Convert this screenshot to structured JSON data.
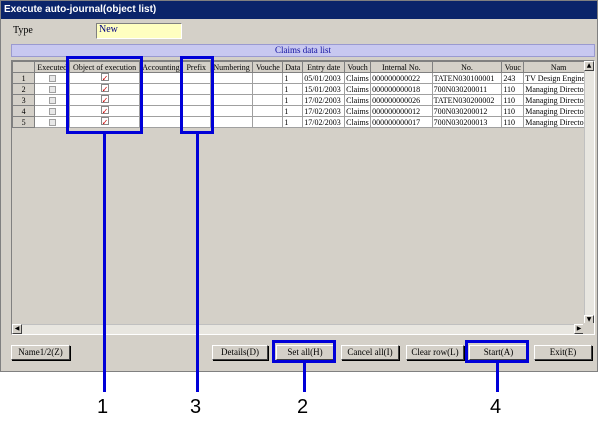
{
  "window": {
    "title": "Execute auto-journal(object list)"
  },
  "form": {
    "type_label": "Type",
    "type_value": "New"
  },
  "grid": {
    "caption": "Claims data list",
    "columns": [
      "Executed",
      "Object of execution",
      "Accounting",
      "Prefix",
      "Numbering",
      "Vouche",
      "Data",
      "Entry date",
      "Vouch",
      "Internal No.",
      "No.",
      "Vouc",
      "Nam"
    ],
    "rows": [
      {
        "num": "1",
        "data": "1",
        "entry_date": "05/01/2003",
        "vouch": "Claims",
        "internal_no": "000000000022",
        "no": "TATEN030100001",
        "vouc": "243",
        "name": "TV Design Engine"
      },
      {
        "num": "2",
        "data": "1",
        "entry_date": "15/01/2003",
        "vouch": "Claims",
        "internal_no": "000000000018",
        "no": "700N030200011",
        "vouc": "110",
        "name": "Managing Directo"
      },
      {
        "num": "3",
        "data": "1",
        "entry_date": "17/02/2003",
        "vouch": "Claims",
        "internal_no": "000000000026",
        "no": "TATEN030200002",
        "vouc": "110",
        "name": "Managing Directo"
      },
      {
        "num": "4",
        "data": "1",
        "entry_date": "17/02/2003",
        "vouch": "Claims",
        "internal_no": "000000000012",
        "no": "700N030200012",
        "vouc": "110",
        "name": "Managing Directo"
      },
      {
        "num": "5",
        "data": "1",
        "entry_date": "17/02/2003",
        "vouch": "Claims",
        "internal_no": "000000000017",
        "no": "700N030200013",
        "vouc": "110",
        "name": "Managing Directo"
      }
    ]
  },
  "buttons": {
    "name12": "Name1/2(Z)",
    "details": "Details(D)",
    "set_all": "Set all(H)",
    "cancel_all": "Cancel all(I)",
    "clear_row": "Clear row(L)",
    "start": "Start(A)",
    "exit": "Exit(E)"
  },
  "callouts": {
    "c1": "1",
    "c2": "2",
    "c3": "3",
    "c4": "4"
  },
  "colors": {
    "highlight": "#0000d8",
    "titlebar": "#0a246a",
    "input_bg": "#ffffc0"
  }
}
